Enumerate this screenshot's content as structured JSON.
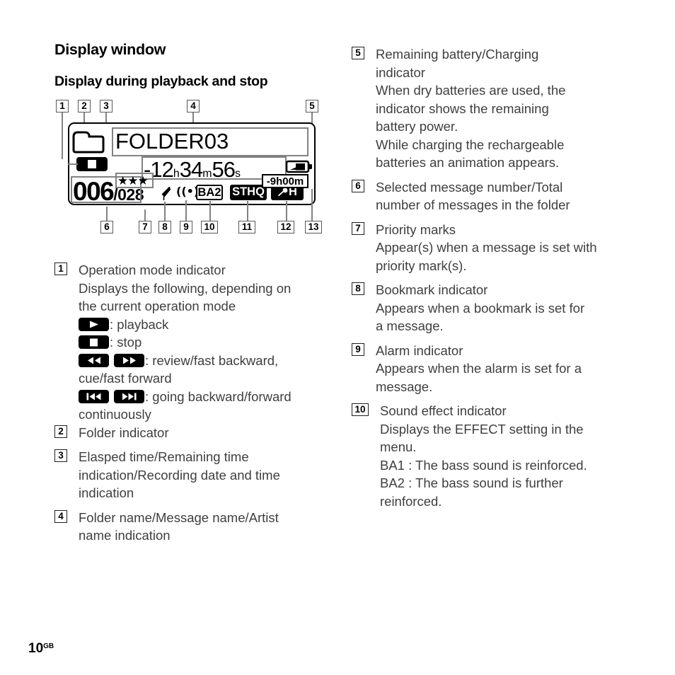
{
  "headings": {
    "h1": "Display window",
    "h2": "Display during playback and stop"
  },
  "lcd": {
    "callout_labels": [
      "1",
      "2",
      "3",
      "4",
      "5",
      "6",
      "7",
      "8",
      "9",
      "10",
      "11",
      "12",
      "13"
    ],
    "folder_icon": "folder-icon",
    "folder_name": "FOLDER03",
    "op_mode_icon": "stop-icon",
    "time": {
      "value": "-12",
      "hours_unit": "h",
      "minutes": "34",
      "minutes_unit": "m",
      "seconds": "56",
      "seconds_unit": "s"
    },
    "battery_icon": "battery-half-icon",
    "message_number": "006",
    "message_total": "/028",
    "priority_marks": "★★★",
    "bookmark_icon": "bookmark-indicator-icon",
    "alarm_icon": "((•))",
    "effect_badge": "BA2",
    "quality_badge": "STHQ",
    "sensitivity_badge": "H",
    "sensitivity_icon": "microphone-icon",
    "remaining_time": "-9h00m"
  },
  "left_column": [
    {
      "num": "1",
      "title": "Operation mode indicator",
      "lines": [
        {
          "type": "text",
          "text": "Displays the following, depending on"
        },
        {
          "type": "text",
          "text": "the current operation mode"
        },
        {
          "type": "icon-text",
          "icons": [
            "play-icon"
          ],
          "text": ": playback"
        },
        {
          "type": "icon-text",
          "icons": [
            "stop-icon"
          ],
          "text": ": stop"
        },
        {
          "type": "icon-text",
          "icons": [
            "rewind-icon",
            "fast-forward-icon"
          ],
          "text": ": review/fast backward,"
        },
        {
          "type": "text",
          "text": "cue/fast forward"
        },
        {
          "type": "icon-text",
          "icons": [
            "skip-back-icon",
            "skip-forward-icon"
          ],
          "text": ": going backward/forward"
        },
        {
          "type": "text",
          "text": "continuously"
        }
      ]
    },
    {
      "num": "2",
      "title": "Folder indicator",
      "lines": []
    },
    {
      "num": "3",
      "title": "Elasped time/Remaining time",
      "title2": "indication/Recording date and time",
      "title3": "indication",
      "lines": []
    },
    {
      "num": "4",
      "title": "Folder name/Message name/Artist",
      "title2": "name indication",
      "lines": []
    }
  ],
  "right_column": [
    {
      "num": "5",
      "title": "Remaining battery/Charging",
      "title2": "indicator",
      "lines": [
        {
          "type": "text",
          "text": "When dry batteries are used, the"
        },
        {
          "type": "text",
          "text": "indicator shows the remaining"
        },
        {
          "type": "text",
          "text": "battery power."
        },
        {
          "type": "text",
          "text": "While charging the rechargeable"
        },
        {
          "type": "text",
          "text": "batteries an animation appears."
        }
      ]
    },
    {
      "num": "6",
      "title": "Selected message number/Total",
      "title2": "number of messages in the folder",
      "lines": []
    },
    {
      "num": "7",
      "title": "Priority marks",
      "lines": [
        {
          "type": "text",
          "text": "Appear(s) when a message is set with"
        },
        {
          "type": "text",
          "text": "priority mark(s)."
        }
      ]
    },
    {
      "num": "8",
      "title": "Bookmark indicator",
      "lines": [
        {
          "type": "text",
          "text": "Appears when a bookmark is set for"
        },
        {
          "type": "text",
          "text": "a message."
        }
      ]
    },
    {
      "num": "9",
      "title": "Alarm indicator",
      "lines": [
        {
          "type": "text",
          "text": "Appears when the alarm is set for a"
        },
        {
          "type": "text",
          "text": "message."
        }
      ]
    },
    {
      "num": "10",
      "title": "Sound effect indicator",
      "lines": [
        {
          "type": "text",
          "text": "Displays the EFFECT setting in the"
        },
        {
          "type": "text",
          "text": "menu."
        },
        {
          "type": "text",
          "text": "BA1 :  The bass sound is reinforced."
        },
        {
          "type": "text",
          "text": "BA2 :  The bass sound is further"
        },
        {
          "type": "text",
          "text": "reinforced."
        }
      ]
    }
  ],
  "footer": {
    "page_number": "10",
    "page_suffix": "GB"
  },
  "colors": {
    "text": "#3f3f42",
    "heading": "#000000",
    "callout_gray": "#808285",
    "lcd_border": "#000000",
    "page_bg": "#ffffff"
  }
}
